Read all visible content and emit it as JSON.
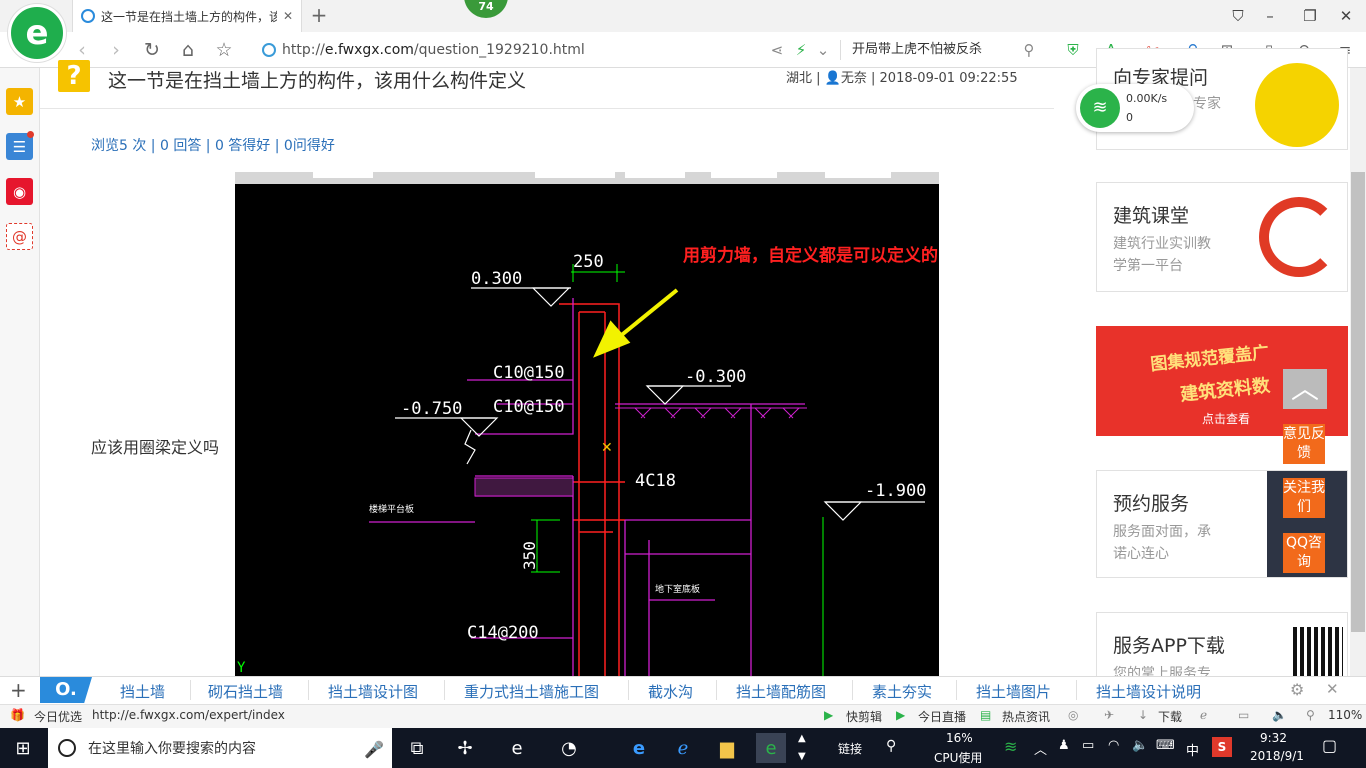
{
  "browser": {
    "tab_title": "这一节是在挡土墙上方的构件，该",
    "tab_close": "✕",
    "new_tab": "+",
    "badge": "74",
    "url_prefix": "http://",
    "url_domain": "e.fwxgx.com",
    "url_path": "/question_1929210.html",
    "search_text": "开局带上虎不怕被反杀",
    "logo_letter": "e"
  },
  "question": {
    "icon": "?",
    "title": "这一节是在挡土墙上方的构件，该用什么构件定义",
    "region": "湖北",
    "author": "无奈",
    "datetime": "2018-09-01 09:22:55",
    "stats": "浏览5 次 | 0 回答 | 0 答得好 | 0问得好",
    "body": "应该用圈梁定义吗"
  },
  "drawing": {
    "annotation": "用剪力墙，自定义都是可以定义的",
    "dim_250": "250",
    "elev_top": "0.300",
    "elev_m0300": "-0.300",
    "elev_m0750": "-0.750",
    "elev_m1900": "-1.900",
    "rebar1": "C10@150",
    "rebar2": "C10@150",
    "rebar3": "4C18",
    "rebar4": "C14@200",
    "dim_350": "350",
    "label_slab": "楼梯平台板",
    "label_base": "地下室底板",
    "axis_y": "Y"
  },
  "ads": {
    "expert_title": "向专家提问",
    "expert_sub": "专家",
    "wifi_speed": "0.00K/s",
    "wifi_count": "0",
    "course_title": "建筑课堂",
    "course_sub1": "建筑行业实训教",
    "course_sub2": "学第一平台",
    "banner_line1": "图集规范覆盖广",
    "banner_line2": "建筑资料数",
    "banner_btn": "点击查看",
    "service_title": "预约服务",
    "service_sub1": "服务面对面，承",
    "service_sub2": "诺心连心",
    "app_title": "服务APP下载",
    "app_sub": "您的掌上服务专"
  },
  "float": {
    "feedback": "意见反馈",
    "follow": "关注我们",
    "qq": "QQ咨询",
    "top": "︿"
  },
  "keywords": [
    "挡土墙",
    "砌石挡土墙",
    "挡土墙设计图",
    "重力式挡土墙施工图",
    "截水沟",
    "挡土墙配筋图",
    "素土夯实",
    "挡土墙图片",
    "挡土墙设计说明"
  ],
  "statusbar": {
    "today": "今日优选",
    "link_url": "http://e.fwxgx.com/expert/index",
    "kuaijian": "快剪辑",
    "live": "今日直播",
    "news": "热点资讯",
    "download": "下载",
    "zoom": "110%"
  },
  "taskbar": {
    "search_placeholder": "在这里输入你要搜索的内容",
    "link": "链接",
    "cpu_pct": "16%",
    "cpu_label": "CPU使用",
    "ime": "中",
    "time": "9:32",
    "date": "2018/9/1"
  }
}
